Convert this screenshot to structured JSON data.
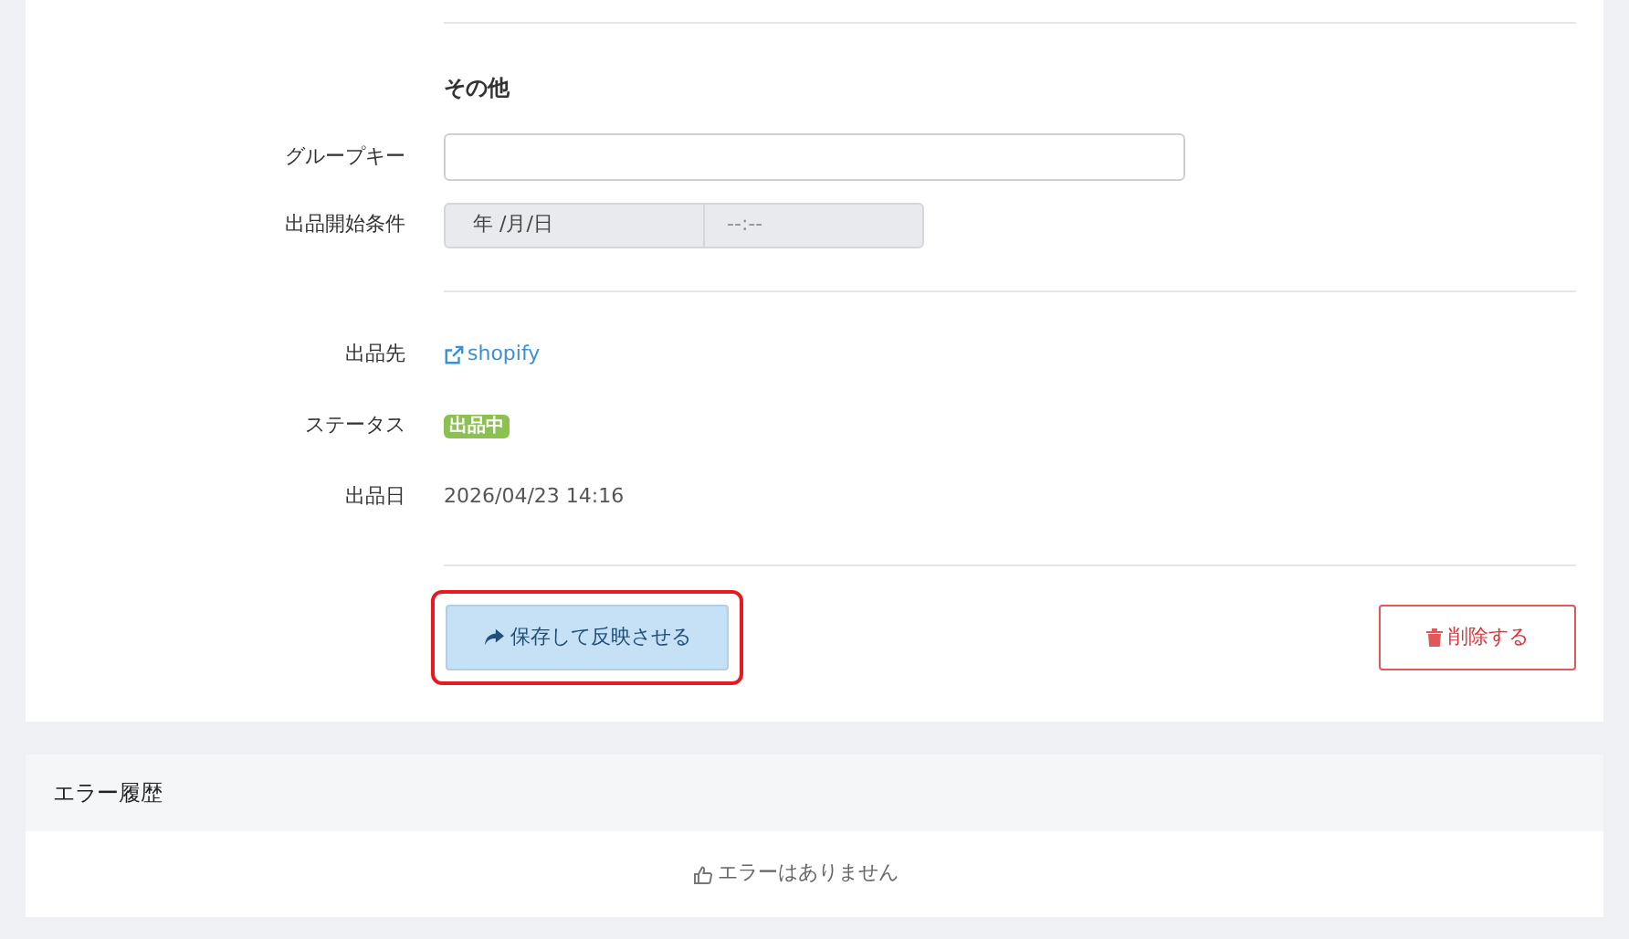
{
  "form": {
    "section_title": "その他",
    "fields": [
      {
        "kind": "text",
        "label": "グループキー"
      },
      {
        "kind": "datetime",
        "label": "出品開始条件",
        "date_placeholder": "年 /月/日",
        "time_placeholder": "--:--"
      }
    ],
    "info": [
      {
        "kind": "link",
        "label": "出品先",
        "value": "shopify"
      },
      {
        "kind": "badge",
        "label": "ステータス",
        "value": "出品中",
        "color": "#8cc152"
      },
      {
        "kind": "text",
        "label": "出品日",
        "value": "2026/04/23 14:16"
      }
    ],
    "save_button": {
      "label": "保存して反映させる",
      "highlighted": true
    },
    "delete_button": {
      "label": "削除する"
    }
  },
  "error_history": {
    "title": "エラー履歴",
    "empty_message": "エラーはありません"
  }
}
